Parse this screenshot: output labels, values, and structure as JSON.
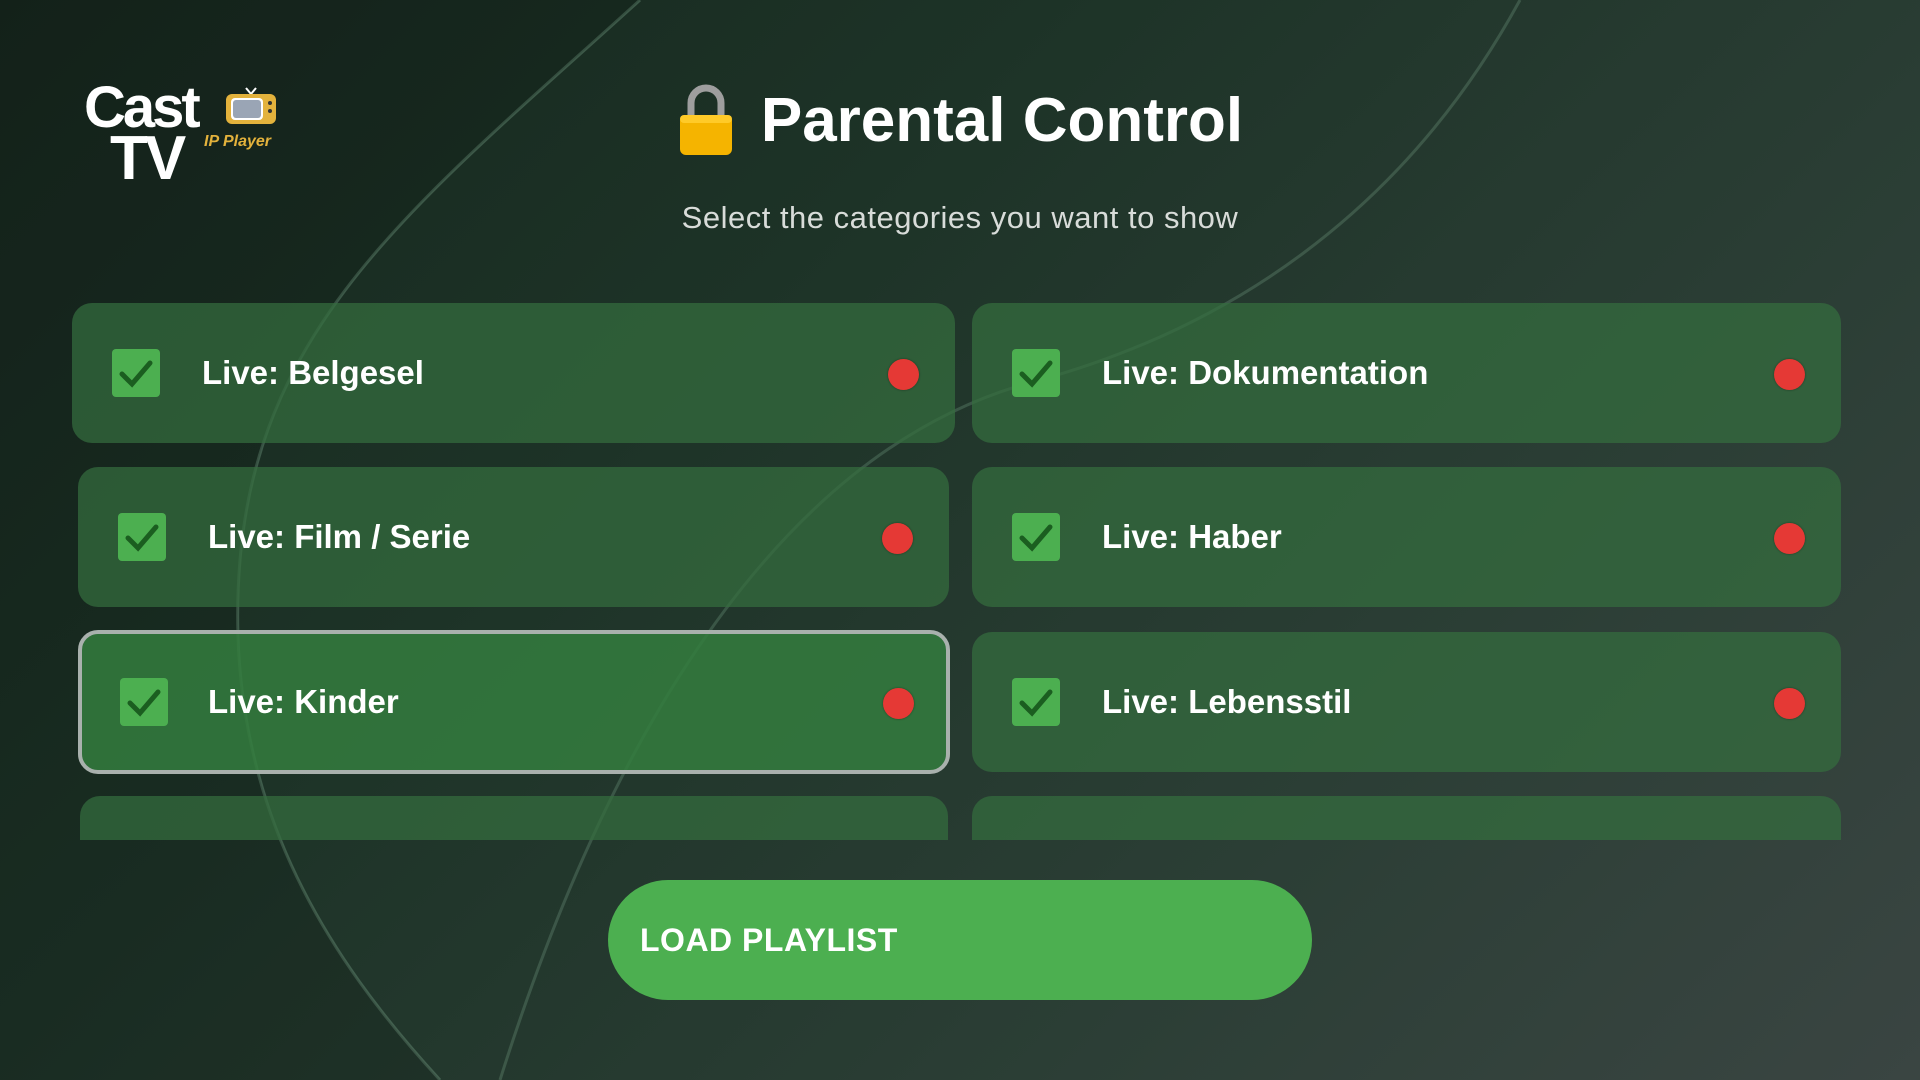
{
  "logo": {
    "main": "Cast",
    "secondary": "TV",
    "tagline": "IP Player",
    "icon": "tv-icon"
  },
  "header": {
    "icon": "lock-icon",
    "title": "Parental Control",
    "subtitle": "Select the categories you want to show"
  },
  "categories": [
    {
      "label": "Live: Belgesel",
      "checked": true,
      "status": "red"
    },
    {
      "label": "Live: Dokumentation",
      "checked": true,
      "status": "red"
    },
    {
      "label": "Live: Film / Serie",
      "checked": true,
      "status": "red"
    },
    {
      "label": "Live: Haber",
      "checked": true,
      "status": "red"
    },
    {
      "label": "Live: Kinder",
      "checked": true,
      "status": "red",
      "focused": true
    },
    {
      "label": "Live: Lebensstil",
      "checked": true,
      "status": "red"
    },
    {
      "label": "",
      "checked": true,
      "status": "red"
    },
    {
      "label": "",
      "checked": true,
      "status": "red"
    }
  ],
  "actions": {
    "load_playlist": "LOAD PLAYLIST"
  },
  "colors": {
    "accent": "#4caf50",
    "card": "#346e3e",
    "status_dot": "#e53935",
    "focus_border": "#a9b1ad"
  }
}
